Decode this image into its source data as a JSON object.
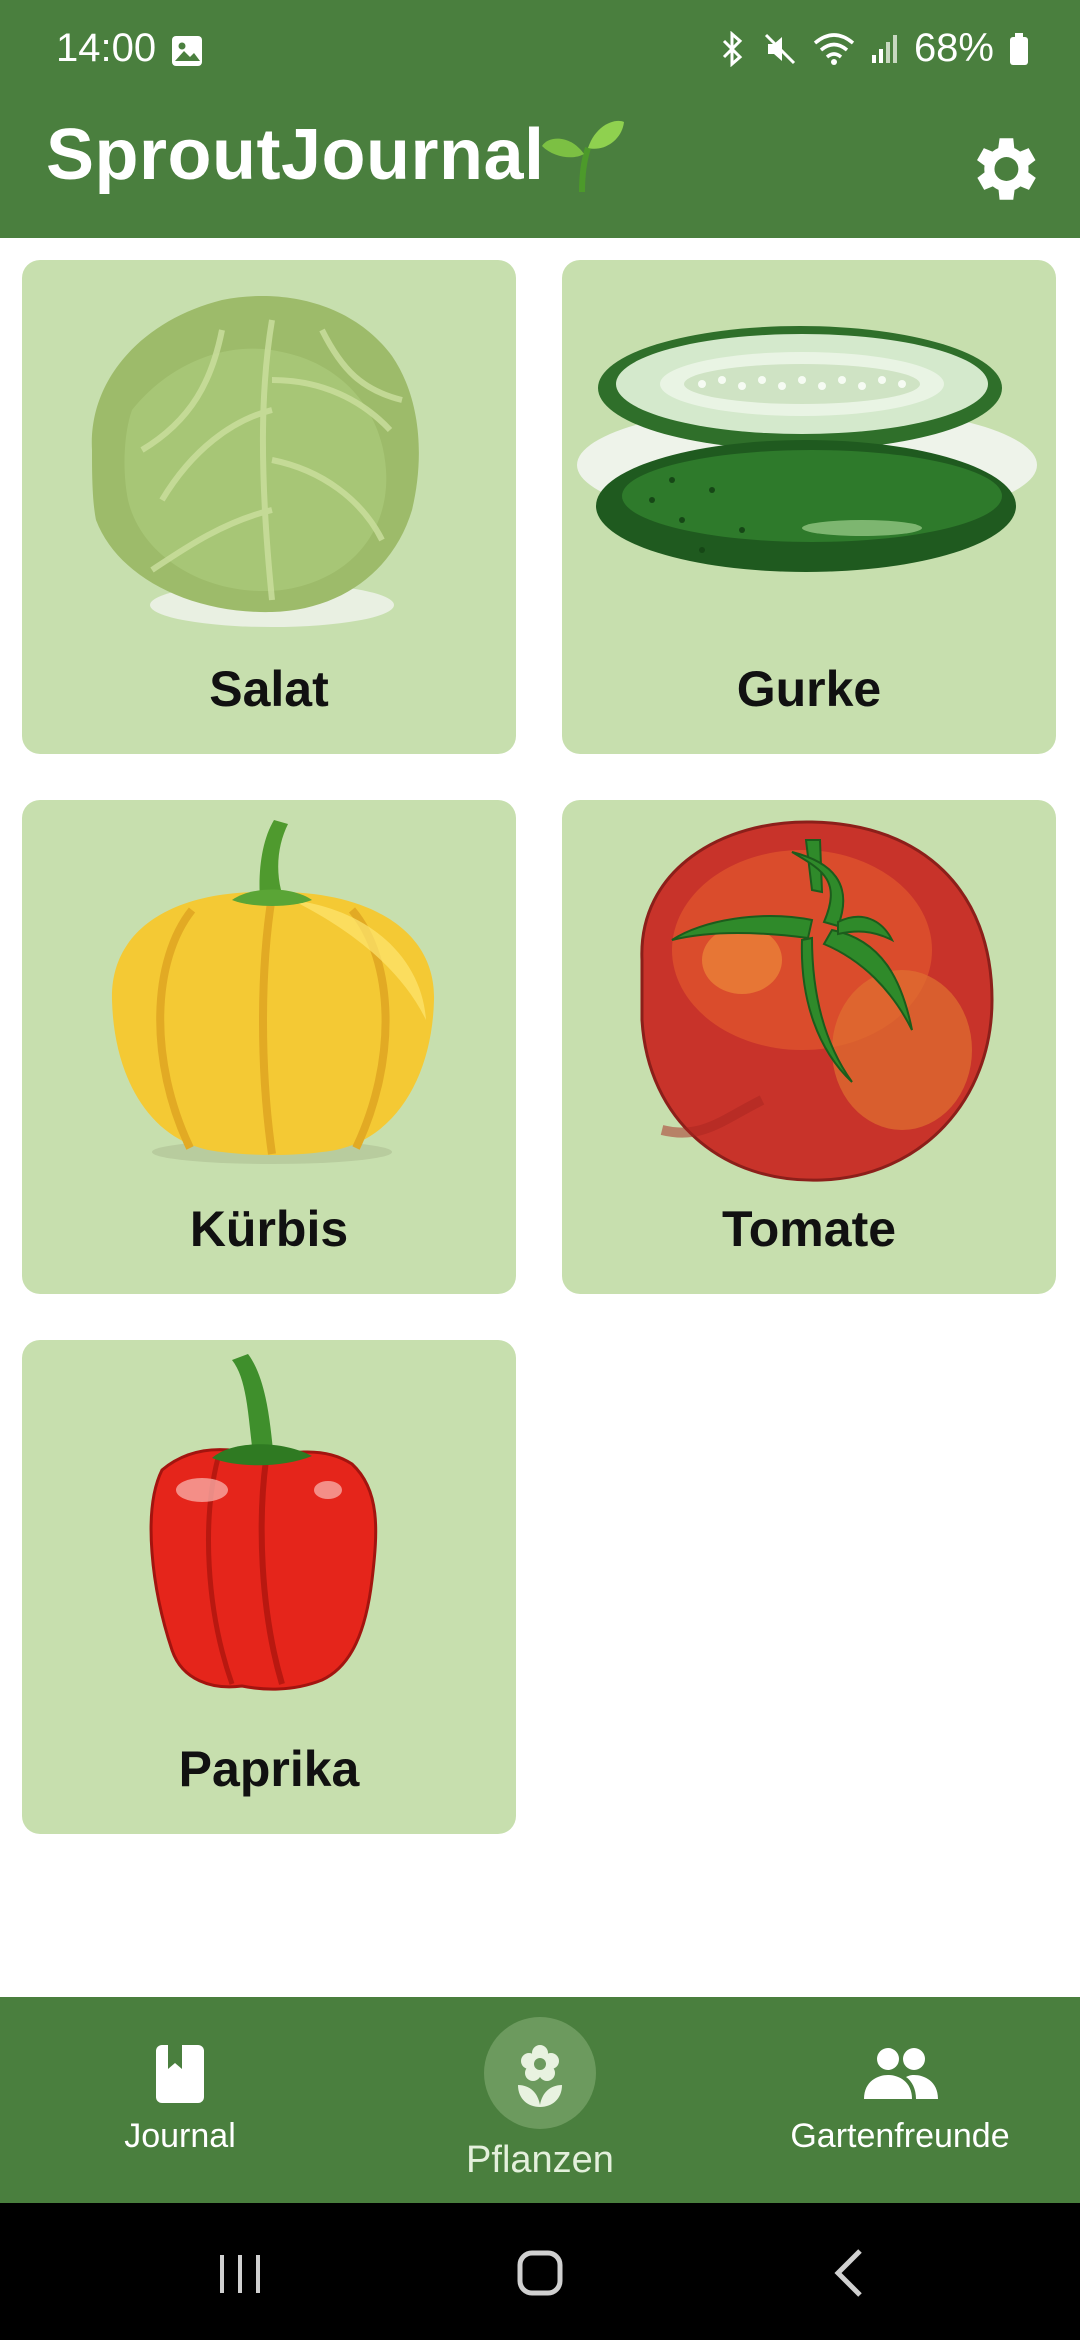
{
  "status_bar": {
    "time": "14:00",
    "battery": "68%",
    "icons": [
      "image-icon",
      "bluetooth-icon",
      "mute-icon",
      "wifi-icon",
      "signal-icon",
      "battery-icon"
    ]
  },
  "app_bar": {
    "title": "SproutJournal",
    "title_icon": "sprout-icon",
    "settings_icon": "gear-icon"
  },
  "plants": [
    {
      "name": "Salat",
      "icon": "lettuce-icon"
    },
    {
      "name": "Gurke",
      "icon": "cucumber-icon"
    },
    {
      "name": "Kürbis",
      "icon": "pumpkin-icon"
    },
    {
      "name": "Tomate",
      "icon": "tomato-icon"
    },
    {
      "name": "Paprika",
      "icon": "bell-pepper-icon"
    }
  ],
  "bottom_nav": {
    "items": [
      {
        "label": "Journal",
        "icon": "book-icon",
        "active": false
      },
      {
        "label": "Pflanzen",
        "icon": "flower-icon",
        "active": true
      },
      {
        "label": "Gartenfreunde",
        "icon": "people-icon",
        "active": false
      }
    ]
  },
  "colors": {
    "primary": "#4a7f3e",
    "card": "#c7dfae",
    "active_indicator": "#6c9a5e"
  }
}
